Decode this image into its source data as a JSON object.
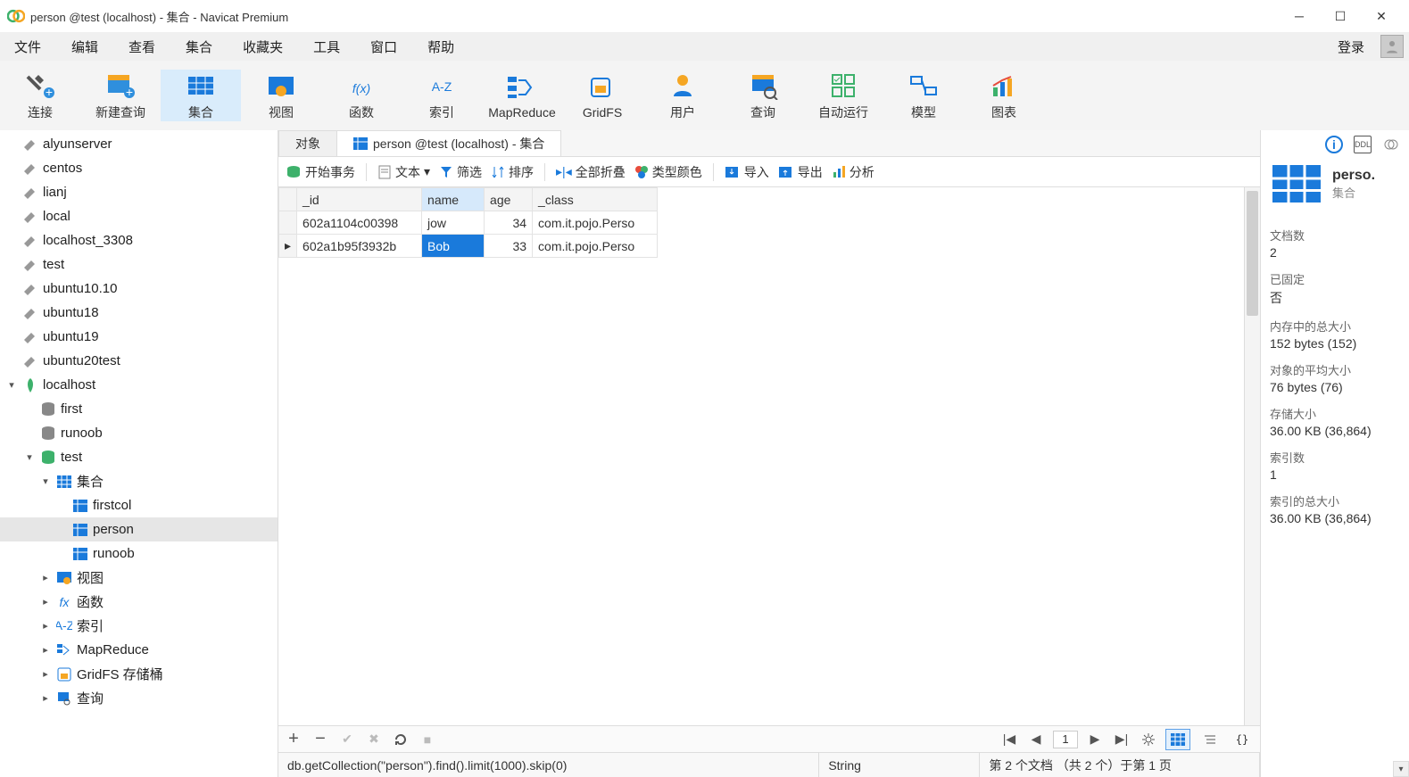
{
  "title": "person @test (localhost) - 集合 - Navicat Premium",
  "menu": [
    "文件",
    "编辑",
    "查看",
    "集合",
    "收藏夹",
    "工具",
    "窗口",
    "帮助"
  ],
  "login": "登录",
  "tools": [
    {
      "label": "连接"
    },
    {
      "label": "新建查询"
    },
    {
      "label": "集合",
      "active": true
    },
    {
      "label": "视图"
    },
    {
      "label": "函数"
    },
    {
      "label": "索引"
    },
    {
      "label": "MapReduce"
    },
    {
      "label": "GridFS"
    },
    {
      "label": "用户"
    },
    {
      "label": "查询"
    },
    {
      "label": "自动运行"
    },
    {
      "label": "模型"
    },
    {
      "label": "图表"
    }
  ],
  "tree_conn": [
    "alyunserver",
    "centos",
    "lianj",
    "local",
    "localhost_3308",
    "test",
    "ubuntu10.10",
    "ubuntu18",
    "ubuntu19",
    "ubuntu20test"
  ],
  "tree_host": "localhost",
  "tree_db": [
    "first",
    "runoob"
  ],
  "tree_db_open": "test",
  "tree_collroot": "集合",
  "tree_colls": [
    "firstcol",
    "person",
    "runoob"
  ],
  "tree_others": [
    {
      "label": "视图"
    },
    {
      "label": "函数"
    },
    {
      "label": "索引"
    },
    {
      "label": "MapReduce"
    },
    {
      "label": "GridFS 存储桶"
    },
    {
      "label": "查询"
    }
  ],
  "tabs": {
    "objects": "对象",
    "doc": "person @test (localhost) - 集合"
  },
  "dtb": {
    "begintx": "开始事务",
    "text": "文本",
    "filter": "筛选",
    "sort": "排序",
    "collapse": "全部折叠",
    "typecolor": "类型颜色",
    "import": "导入",
    "export": "导出",
    "analyze": "分析"
  },
  "grid": {
    "cols": [
      "_id",
      "name",
      "age",
      "_class"
    ],
    "rows": [
      {
        "id": "602a1104c00398",
        "name": "jow",
        "age": 34,
        "cls": "com.it.pojo.Perso"
      },
      {
        "id": "602a1b95f3932b",
        "name": "Bob",
        "age": 33,
        "cls": "com.it.pojo.Perso"
      }
    ]
  },
  "page": "1",
  "status": {
    "query": "db.getCollection(\"person\").find().limit(1000).skip(0)",
    "type": "String",
    "info": "第 2 个文档 （共 2 个）于第 1 页"
  },
  "panel": {
    "name": "perso.",
    "kind": "集合",
    "stats": [
      {
        "k": "文档数",
        "v": "2"
      },
      {
        "k": "已固定",
        "v": "否"
      },
      {
        "k": "内存中的总大小",
        "v": "152 bytes (152)"
      },
      {
        "k": "对象的平均大小",
        "v": "76 bytes (76)"
      },
      {
        "k": "存储大小",
        "v": "36.00 KB (36,864)"
      },
      {
        "k": "索引数",
        "v": "1"
      },
      {
        "k": "索引的总大小",
        "v": "36.00 KB (36,864)"
      }
    ]
  }
}
